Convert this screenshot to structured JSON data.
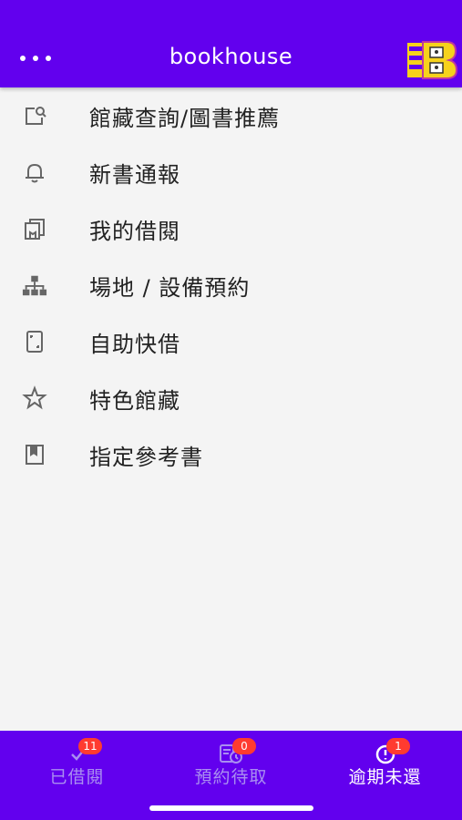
{
  "header": {
    "title": "bookhouse",
    "logo_letter": "B"
  },
  "menu": [
    {
      "label": "館藏查詢/圖書推薦",
      "icon": "search-tag-icon"
    },
    {
      "label": "新書通報",
      "icon": "bell-icon"
    },
    {
      "label": "我的借閱",
      "icon": "books-icon"
    },
    {
      "label": "場地 / 設備預約",
      "icon": "sitemap-icon"
    },
    {
      "label": "自助快借",
      "icon": "phone-scan-icon"
    },
    {
      "label": "特色館藏",
      "icon": "star-icon"
    },
    {
      "label": "指定參考書",
      "icon": "bookmark-book-icon"
    }
  ],
  "tabs": [
    {
      "label": "已借閱",
      "badge": "11",
      "icon": "check-icon"
    },
    {
      "label": "預約待取",
      "badge": "0",
      "icon": "reserve-icon"
    },
    {
      "label": "逾期未還",
      "badge": "1",
      "icon": "alert-icon"
    }
  ],
  "colors": {
    "primary": "#6200ee",
    "badge": "#ff3b30"
  }
}
